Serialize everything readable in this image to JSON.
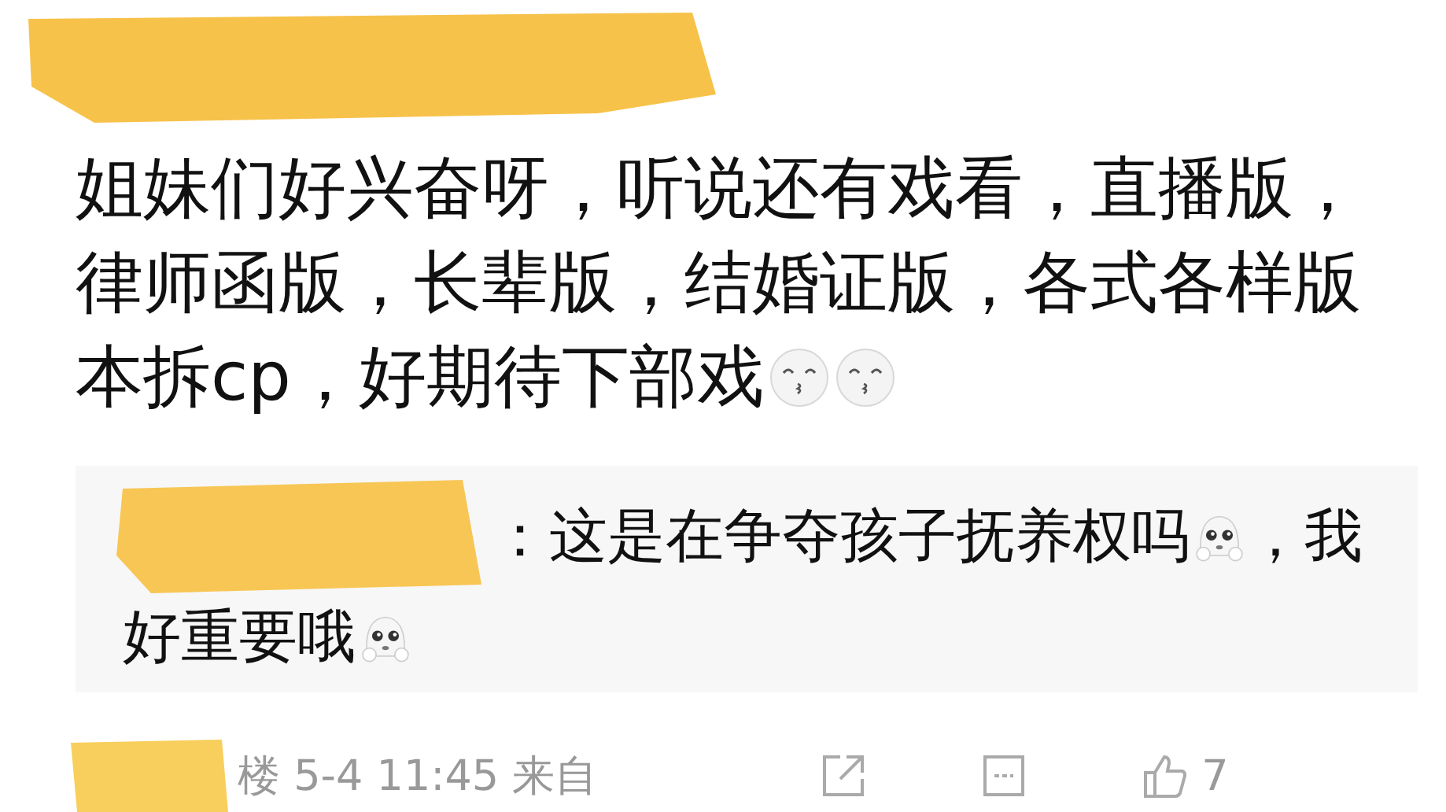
{
  "comment": {
    "lines": [
      [
        {
          "kind": "text",
          "text": "姐妹们好兴奋呀，听说还有戏看，直播版，"
        }
      ],
      [
        {
          "kind": "text",
          "text": "律师函版，长辈版，结婚证版，各式各样版"
        }
      ],
      [
        {
          "kind": "text",
          "text": "本拆cp，好期待下部戏"
        },
        {
          "kind": "kiss-emoji"
        },
        {
          "kind": "kiss-emoji"
        }
      ]
    ]
  },
  "reply": {
    "lines": [
      [
        {
          "kind": "redacted"
        },
        {
          "kind": "text",
          "text": "：这是在争夺孩子抚养权吗"
        },
        {
          "kind": "pleading-emoji"
        },
        {
          "kind": "text",
          "text": "，我"
        }
      ],
      [
        {
          "kind": "text",
          "text": "好重要哦"
        },
        {
          "kind": "pleading-emoji"
        }
      ]
    ]
  },
  "footer": {
    "meta": "楼 5-4 11:45 来自",
    "like_count": "7"
  }
}
